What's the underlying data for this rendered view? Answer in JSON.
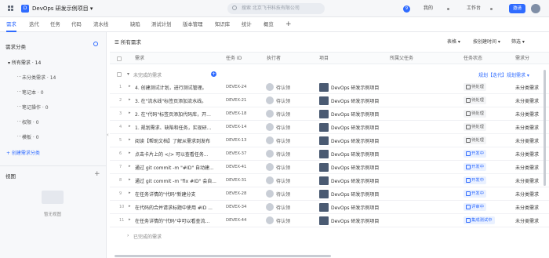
{
  "topbar": {
    "project_badge": "D",
    "project_title": "DevOps 研发示例项目 ▾",
    "search_placeholder": "搜索 北京飞书科技有限公司",
    "notification_count": "9",
    "mine": "我的",
    "workspace": "工作台",
    "invite": "邀请"
  },
  "nav": {
    "tabs": [
      "需求",
      "迭代",
      "任务",
      "代码",
      "流水线",
      "缺陷",
      "测试计划",
      "版本管理",
      "知识库",
      "统计",
      "概览"
    ],
    "active_index": 0,
    "add_label": "+"
  },
  "sidebar": {
    "heading": "需求分类",
    "all_label": "所有需求 · 14",
    "categories": [
      "未分类需求 · 14",
      "笔记本 · 0",
      "笔记操作 · 0",
      "权限 · 0",
      "模板 · 0"
    ],
    "create_link": "+ 创建需求分类",
    "view_heading": "视图",
    "view_plus": "+",
    "empty_text": "暂无视图"
  },
  "toolbar": {
    "title": "所有需求",
    "table": "表格 ▾",
    "sort": "按创建时间 ▾",
    "filter": "筛选 ▾"
  },
  "columns": [
    "需求",
    "任务 ID",
    "执行者",
    "项目",
    "所属父任务",
    "任务状态",
    "需求分"
  ],
  "group": {
    "title": "未完成的需求",
    "add": "+",
    "link": "规划【迭代】规划需求 ▾"
  },
  "rows": [
    {
      "num": "1",
      "title": "4. 创建测试计划，进行测试管理。",
      "id": "DEVEX-24",
      "who": "待认领",
      "project": "DevOps 研发示例项目",
      "status": "待处理",
      "status_type": "todo",
      "cat": "未分类需求"
    },
    {
      "num": "2",
      "title": "3. 在\"流水线\"标签页添加流水线。",
      "id": "DEVEX-21",
      "who": "待认领",
      "project": "DevOps 研发示例项目",
      "status": "待处理",
      "status_type": "todo",
      "cat": "未分类需求"
    },
    {
      "num": "3",
      "title": "2. 在\"代码\"标签页添加代码库，开...",
      "id": "DEVEX-18",
      "who": "待认领",
      "project": "DevOps 研发示例项目",
      "status": "待处理",
      "status_type": "todo",
      "cat": "未分类需求"
    },
    {
      "num": "4",
      "title": "1. 规划需求、缺陷和任务，实现研...",
      "id": "DEVEX-14",
      "who": "待认领",
      "project": "DevOps 研发示例项目",
      "status": "待处理",
      "status_type": "todo",
      "cat": "未分类需求"
    },
    {
      "num": "5",
      "title": "阅读【帮助文档】了解从需求到发布",
      "id": "DEVEX-13",
      "who": "待认领",
      "project": "DevOps 研发示例项目",
      "status": "待处理",
      "status_type": "todo",
      "cat": "未分类需求"
    },
    {
      "num": "6",
      "title": "点击卡片上的 </> 可以查看任务...",
      "id": "DEVEX-37",
      "who": "待认领",
      "project": "DevOps 研发示例项目",
      "status": "开发中",
      "status_type": "dev",
      "cat": "未分类需求"
    },
    {
      "num": "7",
      "title": "通过 git commit -m \"#ID\" 自动建...",
      "id": "DEVEX-41",
      "who": "待认领",
      "project": "DevOps 研发示例项目",
      "status": "开发中",
      "status_type": "dev",
      "cat": "未分类需求"
    },
    {
      "num": "8",
      "title": "通过 git commit -m \"fix #ID\" 会自...",
      "id": "DEVEX-31",
      "who": "待认领",
      "project": "DevOps 研发示例项目",
      "status": "开发中",
      "status_type": "dev",
      "cat": "未分类需求"
    },
    {
      "num": "9",
      "title": "在任务详情的\"代码\"新建分支",
      "id": "DEVEX-28",
      "who": "待认领",
      "project": "DevOps 研发示例项目",
      "status": "开发中",
      "status_type": "dev",
      "cat": "未分类需求"
    },
    {
      "num": "10",
      "title": "在代码的合并请求标题中使用 #ID ...",
      "id": "DEVEX-34",
      "who": "待认领",
      "project": "DevOps 研发示例项目",
      "status": "评审中",
      "status_type": "review",
      "cat": "未分类需求"
    },
    {
      "num": "11",
      "title": "在任务详情的\"代码\"中可以看查流...",
      "id": "DEVEX-44",
      "who": "待认领",
      "project": "DevOps 研发示例项目",
      "status": "集成测试中",
      "status_type": "test",
      "cat": "未分类需求"
    }
  ],
  "done_group": {
    "title": "已完成的需求"
  },
  "collapse_icon": "‹"
}
